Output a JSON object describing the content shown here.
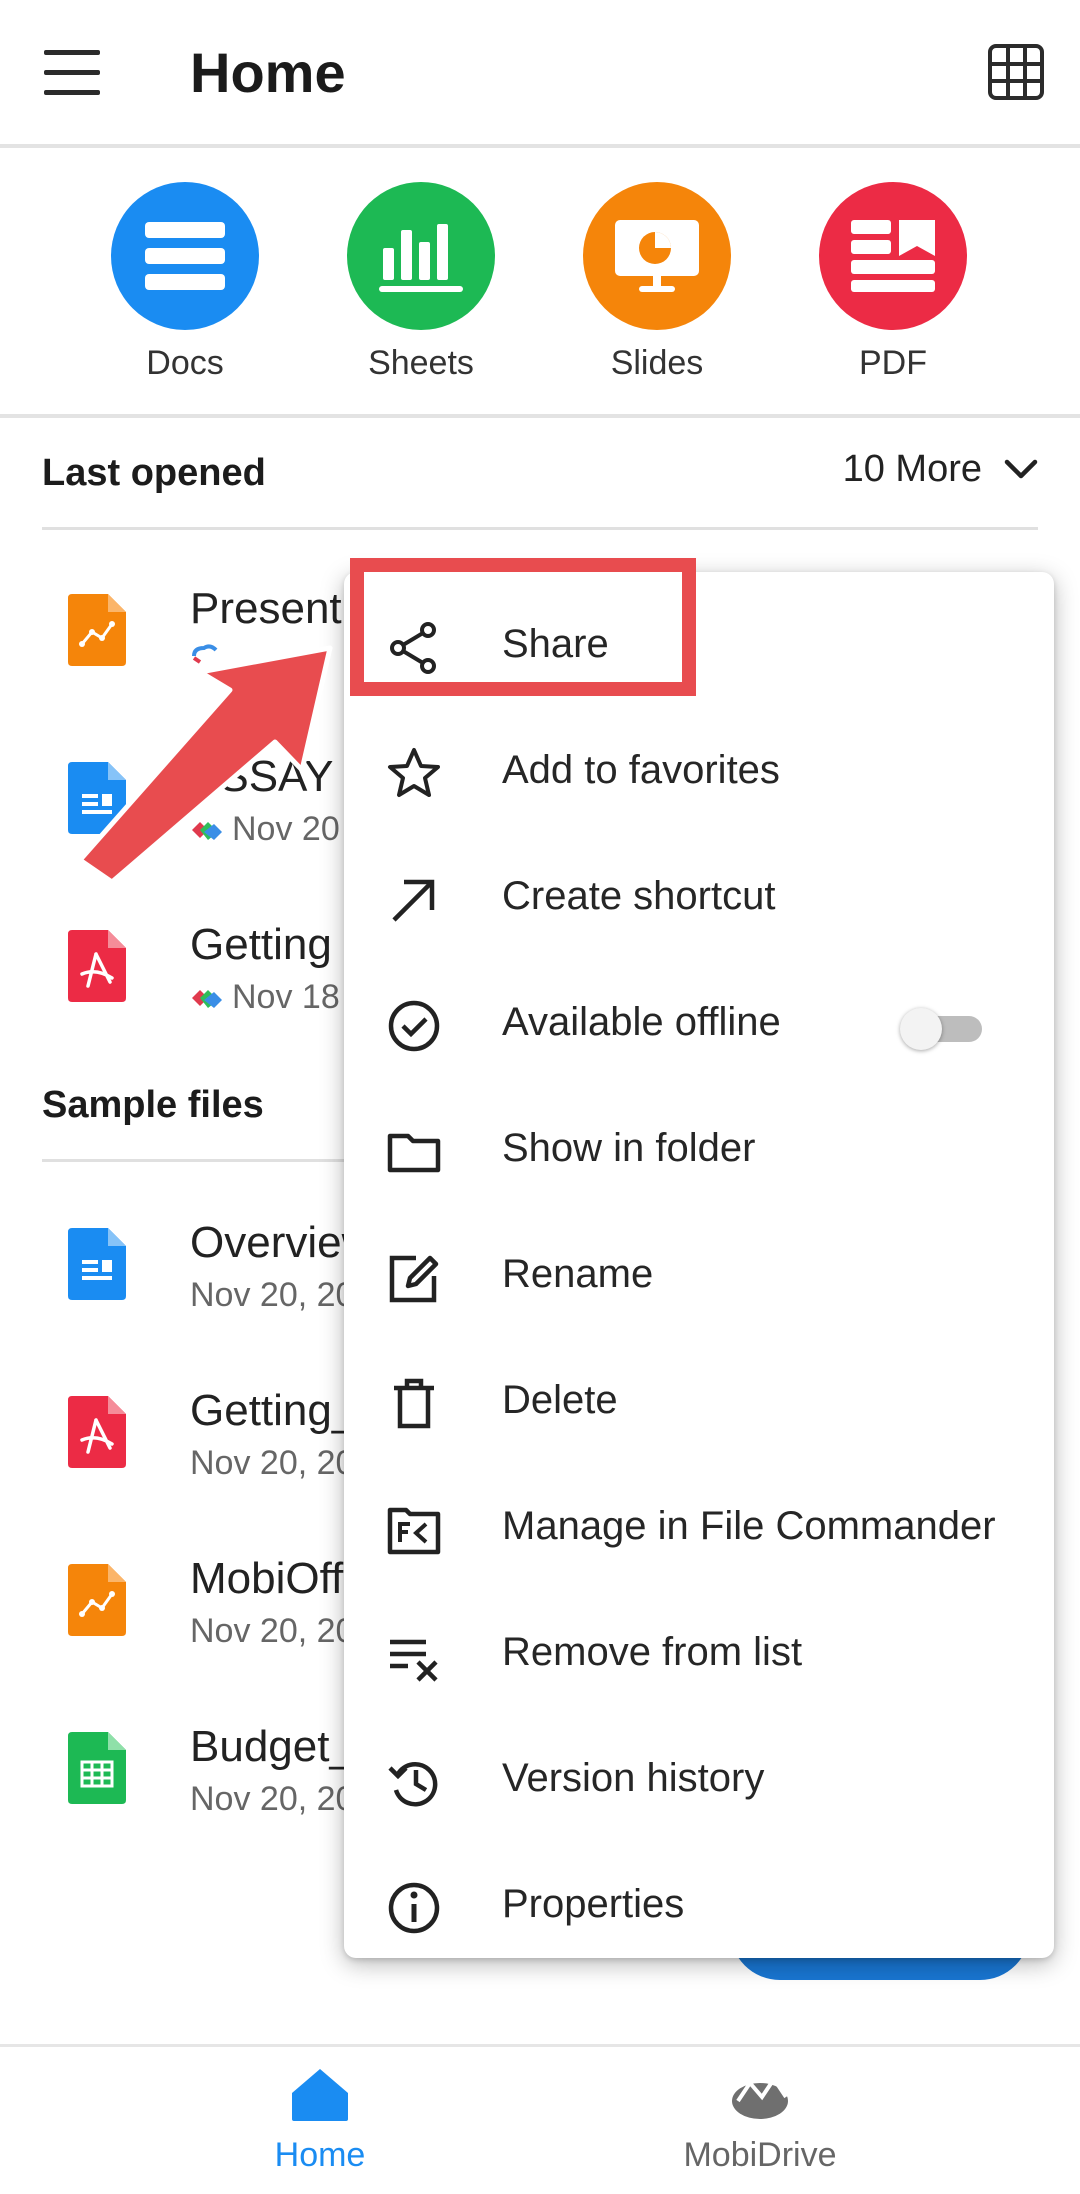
{
  "appbar": {
    "title": "Home"
  },
  "quick_create": [
    {
      "label": "Docs",
      "color": "#1a8cf2"
    },
    {
      "label": "Sheets",
      "color": "#1db954"
    },
    {
      "label": "Slides",
      "color": "#f5850a"
    },
    {
      "label": "PDF",
      "color": "#ec2b45"
    }
  ],
  "last_opened": {
    "title": "Last opened",
    "more_label": "10 More",
    "files": [
      {
        "name": "Present",
        "meta": "",
        "icon": "slides-file-icon"
      },
      {
        "name": "ESSAY T",
        "meta": "Nov 20",
        "icon": "docs-file-icon"
      },
      {
        "name": "Getting",
        "meta": "Nov 18",
        "icon": "pdf-file-icon"
      }
    ]
  },
  "sample_files": {
    "title": "Sample files",
    "files": [
      {
        "name": "Overview",
        "meta": "Nov 20, 20",
        "icon": "docs-file-icon"
      },
      {
        "name": "Getting_",
        "meta": "Nov 20, 20",
        "icon": "pdf-file-icon"
      },
      {
        "name": "MobiOff",
        "meta": "Nov 20, 20",
        "icon": "slides-file-icon"
      },
      {
        "name": "Budget_",
        "meta": "Nov 20, 20",
        "icon": "sheets-file-icon"
      }
    ]
  },
  "context_menu": {
    "items": [
      {
        "label": "Share",
        "icon": "share-icon"
      },
      {
        "label": "Add to favorites",
        "icon": "star-icon"
      },
      {
        "label": "Create shortcut",
        "icon": "arrow-up-right-icon"
      },
      {
        "label": "Available offline",
        "icon": "check-circle-icon",
        "toggle": false
      },
      {
        "label": "Show in folder",
        "icon": "folder-icon"
      },
      {
        "label": "Rename",
        "icon": "edit-icon"
      },
      {
        "label": "Delete",
        "icon": "trash-icon"
      },
      {
        "label": "Manage in File Commander",
        "icon": "file-commander-icon"
      },
      {
        "label": "Remove from list",
        "icon": "remove-list-icon"
      },
      {
        "label": "Version history",
        "icon": "history-icon"
      },
      {
        "label": "Properties",
        "icon": "info-icon"
      }
    ]
  },
  "bottom_nav": {
    "home_label": "Home",
    "drive_label": "MobiDrive",
    "active_color": "#1a8cf2"
  }
}
